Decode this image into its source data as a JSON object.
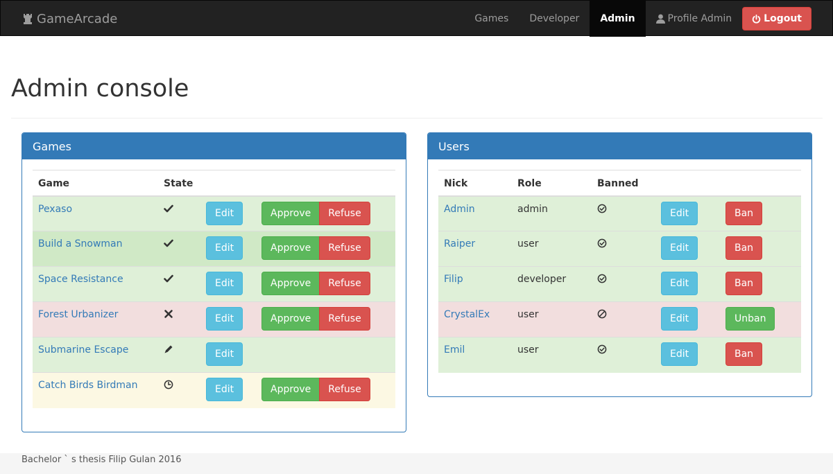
{
  "navbar": {
    "brand": "GameArcade",
    "links": [
      "Games",
      "Developer",
      "Admin"
    ],
    "profile": "Profile Admin",
    "logout": "Logout"
  },
  "page": {
    "title": "Admin console"
  },
  "games_panel": {
    "title": "Games",
    "headers": [
      "Game",
      "State"
    ],
    "rows": [
      {
        "name": "Pexaso",
        "state": "check",
        "edit": "Edit",
        "approve": "Approve",
        "refuse": "Refuse"
      },
      {
        "name": "Build a Snowman",
        "state": "check",
        "edit": "Edit",
        "approve": "Approve",
        "refuse": "Refuse"
      },
      {
        "name": "Space Resistance",
        "state": "check",
        "edit": "Edit",
        "approve": "Approve",
        "refuse": "Refuse"
      },
      {
        "name": "Forest Urbanizer",
        "state": "cross",
        "edit": "Edit",
        "approve": "Approve",
        "refuse": "Refuse"
      },
      {
        "name": "Submarine Escape",
        "state": "pencil",
        "edit": "Edit"
      },
      {
        "name": "Catch Birds Birdman",
        "state": "clock",
        "edit": "Edit",
        "approve": "Approve",
        "refuse": "Refuse"
      }
    ]
  },
  "users_panel": {
    "title": "Users",
    "headers": [
      "Nick",
      "Role",
      "Banned"
    ],
    "rows": [
      {
        "nick": "Admin",
        "role": "admin",
        "banned": "ok-circle",
        "edit": "Edit",
        "action": "Ban"
      },
      {
        "nick": "Raiper",
        "role": "user",
        "banned": "ok-circle",
        "edit": "Edit",
        "action": "Ban"
      },
      {
        "nick": "Filip",
        "role": "developer",
        "banned": "ok-circle",
        "edit": "Edit",
        "action": "Ban"
      },
      {
        "nick": "CrystalEx",
        "role": "user",
        "banned": "ban-circle",
        "edit": "Edit",
        "action": "Unban"
      },
      {
        "nick": "Emil",
        "role": "user",
        "banned": "ok-circle",
        "edit": "Edit",
        "action": "Ban"
      }
    ]
  },
  "footer": {
    "text": "Bachelor ` s thesis Filip Gulan 2016"
  },
  "colors": {
    "primary": "#337ab7",
    "info": "#5bc0de",
    "success": "#5cb85c",
    "danger": "#d9534f",
    "row_success": "#dff0d8",
    "row_danger": "#f2dede",
    "row_warning": "#fcf8e3"
  }
}
